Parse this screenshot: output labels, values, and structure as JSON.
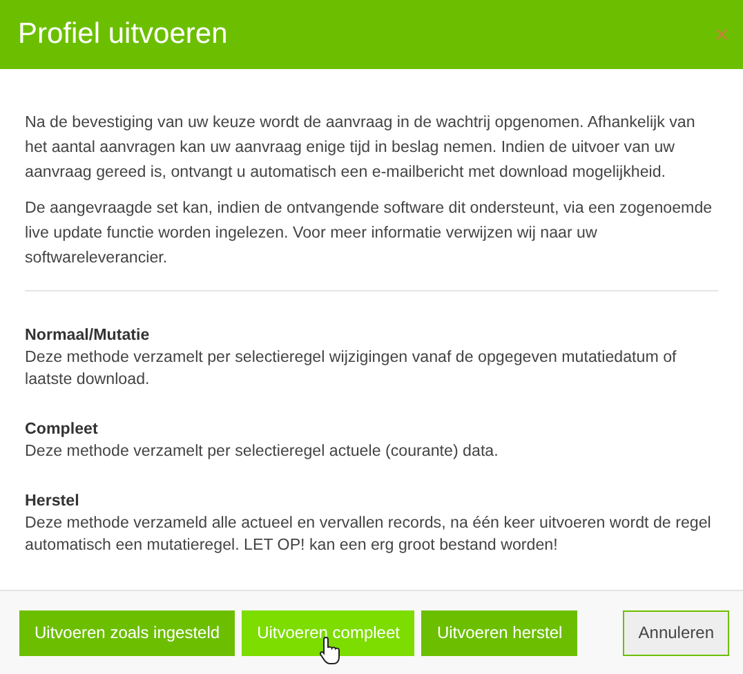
{
  "dialog": {
    "title": "Profiel uitvoeren",
    "close": "×",
    "intro": [
      "Na de bevestiging van uw keuze wordt de aanvraag in de wachtrij opgenomen. Afhankelijk van het aantal aanvragen kan uw aanvraag enige tijd in beslag nemen. Indien de uitvoer van uw aanvraag gereed is, ontvangt u automatisch een e-mailbericht met download mogelijkheid.",
      "De aangevraagde set kan, indien de ontvangende software dit ondersteunt, via een zogenoemde live update functie worden ingelezen. Voor meer informatie verwijzen wij naar uw softwareleverancier."
    ],
    "methods": [
      {
        "title": "Normaal/Mutatie",
        "text": "Deze methode verzamelt per selectieregel wijzigingen vanaf de opgegeven mutatiedatum of laatste download."
      },
      {
        "title": "Compleet",
        "text": "Deze methode verzamelt per selectieregel actuele (courante) data."
      },
      {
        "title": "Herstel",
        "text": "Deze methode verzameld alle actueel en vervallen records, na één keer uitvoeren wordt de regel automatisch een mutatieregel. LET OP! kan een erg groot bestand worden!"
      }
    ],
    "buttons": [
      {
        "label": "Uitvoeren zoals ingesteld",
        "kind": "primary",
        "hovered": false
      },
      {
        "label": "Uitvoeren compleet",
        "kind": "primary",
        "hovered": true
      },
      {
        "label": "Uitvoeren herstel",
        "kind": "primary",
        "hovered": false
      },
      {
        "label": "Annuleren",
        "kind": "cancel",
        "hovered": false
      }
    ]
  }
}
